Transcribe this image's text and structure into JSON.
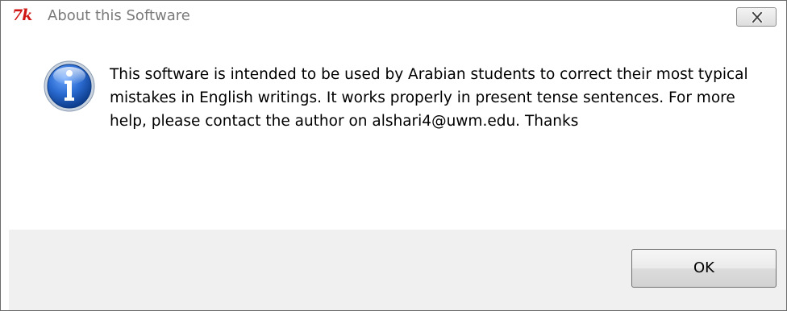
{
  "window": {
    "app_icon": "tk-feather-icon",
    "title": "About this Software",
    "close_icon": "close-x-icon"
  },
  "dialog": {
    "icon": "info-icon",
    "message": "This software is intended to be used by Arabian students to correct their most typical mistakes in English writings. It works properly in present tense sentences. For more help, please contact the author on alshari4@uwm.edu. Thanks"
  },
  "buttons": {
    "ok_label": "OK"
  },
  "colors": {
    "tk_logo": "#d01515",
    "info_icon_blue": "#1e5ab5",
    "footer_bg": "#f0f0f0"
  }
}
